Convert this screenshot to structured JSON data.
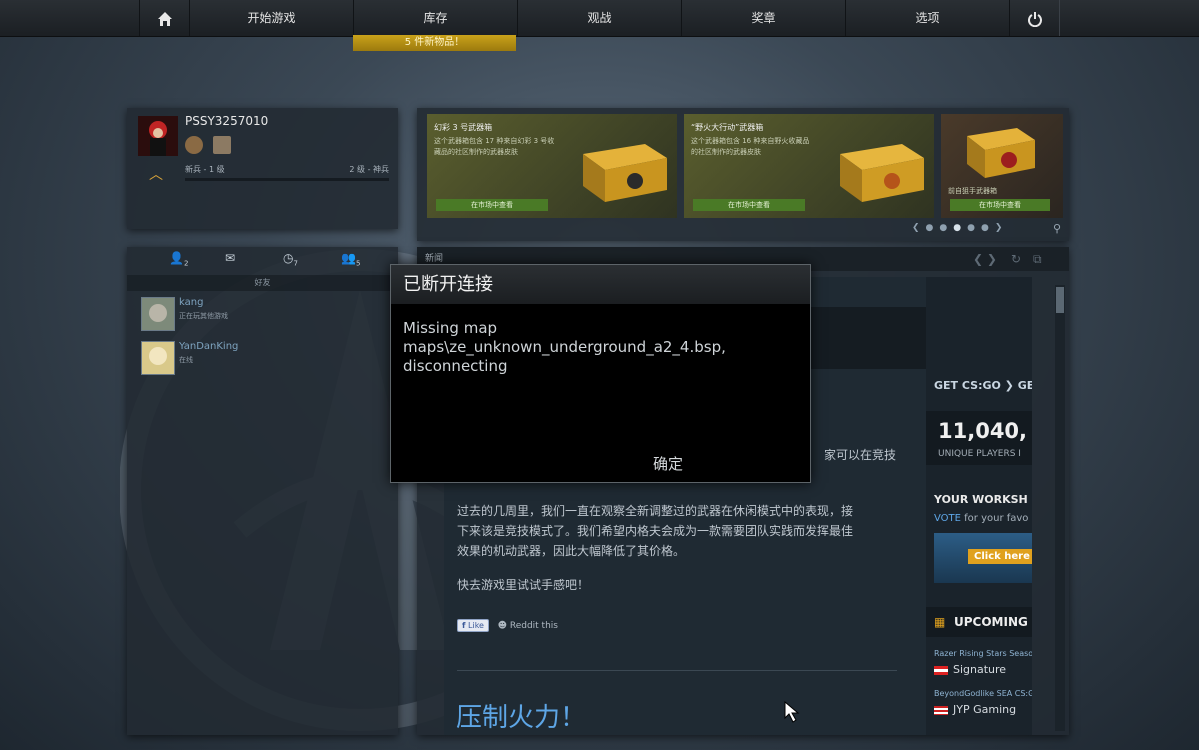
{
  "nav": {
    "play": "开始游戏",
    "inventory": "库存",
    "watch": "观战",
    "awards": "奖章",
    "options": "选项",
    "new_items": "5 件新物品！"
  },
  "profile": {
    "name": "PSSY3257010",
    "rank": "新兵 - 1 级",
    "rank_right": "2 级 - 神兵"
  },
  "cases": [
    {
      "title": "幻彩 3 号武器箱",
      "desc": "这个武器箱包含 17 种来自幻彩 3 号收藏品的社区制作的武器皮肤",
      "button": "在市场中查看"
    },
    {
      "title": "“野火大行动”武器箱",
      "desc": "这个武器箱包含 16 种来自野火收藏品的社区制作的武器皮肤",
      "button": "在市场中查看"
    },
    {
      "title": "",
      "desc": "前自狙手武器箱",
      "button": "在市场中查看"
    }
  ],
  "friends": {
    "tab_counts": [
      "2",
      "7",
      "5"
    ],
    "label": "好友",
    "list": [
      {
        "name": "kang",
        "status": "正在玩其他游戏"
      },
      {
        "name": "YanDanKing",
        "status": "在线"
      }
    ]
  },
  "news": {
    "header": "新闻",
    "partial_line": "家可以在竞技",
    "paragraph1_line1": "过去的几周里，我们一直在观察全新调整过的武器在休闲模式中的表现，接",
    "paragraph1_line2": "下来该是竞技模式了。我们希望内格夫会成为一款需要团队实践而发挥最佳",
    "paragraph1_line3": "效果的机动武器，因此大幅降低了其价格。",
    "paragraph2": "快去游戏里试试手感吧！",
    "like": "Like",
    "reddit": "Reddit this",
    "heading2": "压制火力！"
  },
  "sidebar": {
    "get": "GET CS:GO ❯  GE",
    "player_count": "11,040,",
    "players_label": "UNIQUE PLAYERS I",
    "workshop": "YOUR WORKSH",
    "vote_prefix": "VOTE",
    "vote_rest": " for your favo",
    "click_here": "Click here",
    "upcoming": "UPCOMING",
    "event1": "Razer Rising Stars Seaso",
    "team1": "Signature",
    "event2": "BeyondGodlike SEA CS:G",
    "team2": "JYP Gaming"
  },
  "dialog": {
    "title": "已断开连接",
    "message": "Missing map\nmaps\\ze_unknown_underground_a2_4.bsp,\ndisconnecting",
    "ok": "确定"
  },
  "colors": {
    "accent_gold": "#c9a21a",
    "link_blue": "#5ea6e6",
    "market_green": "#4a7a26"
  }
}
